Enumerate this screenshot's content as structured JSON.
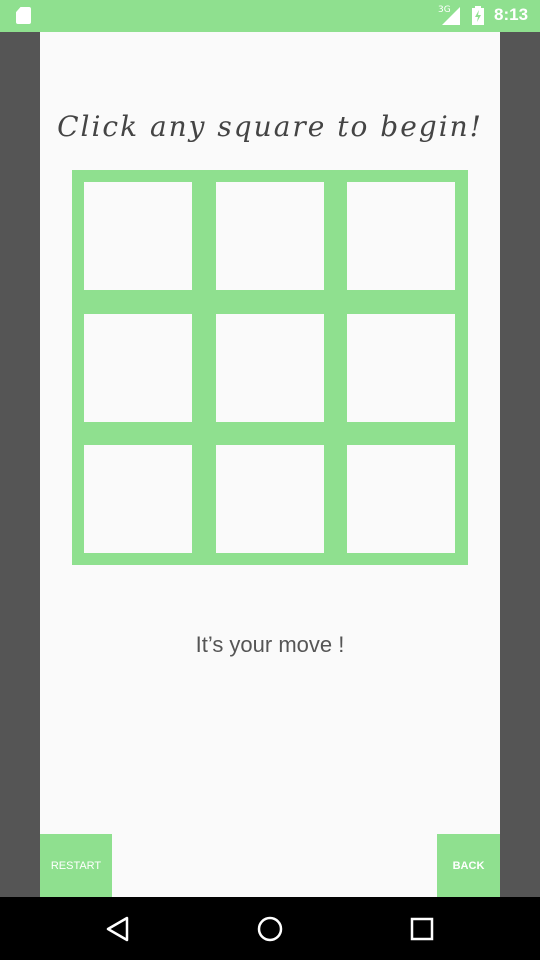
{
  "status_bar": {
    "network_label": "3G",
    "time": "8:13",
    "color": "#8fe08f"
  },
  "game": {
    "instruction": "Click any square to begin!",
    "turn_text": "It’s your move !",
    "board": {
      "cells": [
        "",
        "",
        "",
        "",
        "",
        "",
        "",
        "",
        ""
      ],
      "grid_color": "#8fe08f"
    }
  },
  "buttons": {
    "restart_label": "RESTART",
    "back_label": "BACK"
  },
  "nav_bar": {
    "items": [
      "back-triangle-icon",
      "home-circle-icon",
      "recents-square-icon"
    ]
  }
}
